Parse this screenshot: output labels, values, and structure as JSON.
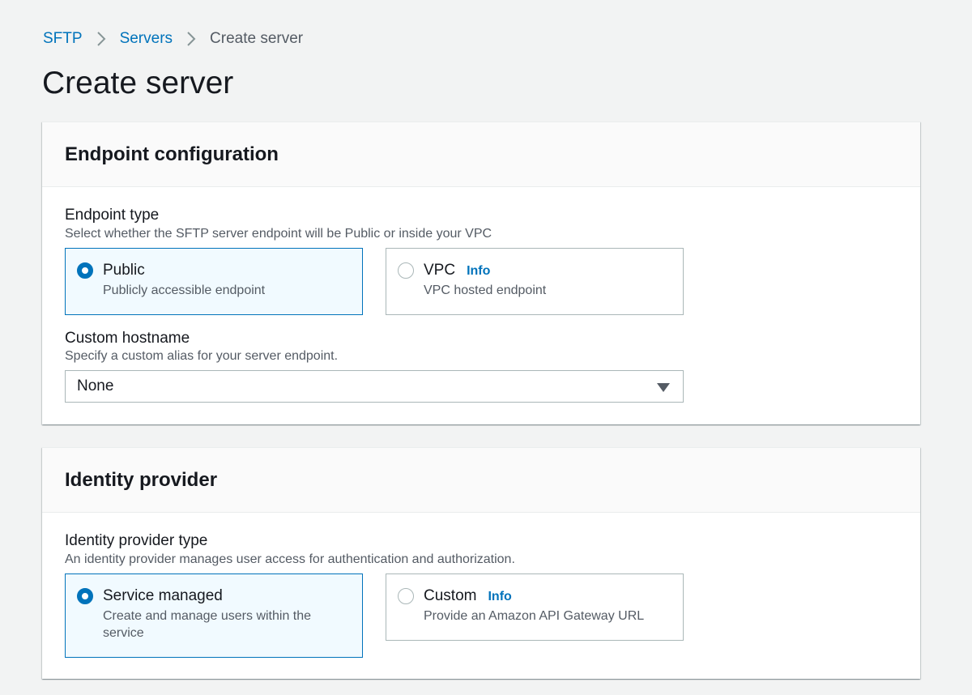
{
  "breadcrumb": {
    "items": [
      "SFTP",
      "Servers"
    ],
    "current": "Create server"
  },
  "page_title": "Create server",
  "endpoint_panel": {
    "title": "Endpoint configuration",
    "endpoint_type": {
      "label": "Endpoint type",
      "description": "Select whether the SFTP server endpoint will be Public or inside your VPC",
      "options": [
        {
          "title": "Public",
          "description": "Publicly accessible endpoint",
          "selected": true
        },
        {
          "title": "VPC",
          "info": "Info",
          "description": "VPC hosted endpoint",
          "selected": false
        }
      ]
    },
    "custom_hostname": {
      "label": "Custom hostname",
      "description": "Specify a custom alias for your server endpoint.",
      "value": "None"
    }
  },
  "identity_panel": {
    "title": "Identity provider",
    "provider_type": {
      "label": "Identity provider type",
      "description": "An identity provider manages user access for authentication and authorization.",
      "options": [
        {
          "title": "Service managed",
          "description": "Create and manage users within the service",
          "selected": true
        },
        {
          "title": "Custom",
          "info": "Info",
          "description": "Provide an Amazon API Gateway URL",
          "selected": false
        }
      ]
    }
  },
  "colors": {
    "link": "#0073bb",
    "selected_bg": "#f1faff",
    "page_bg": "#f2f3f3"
  },
  "icons": {
    "breadcrumb_separator": "chevron-right-icon",
    "select_caret": "caret-down-icon"
  }
}
